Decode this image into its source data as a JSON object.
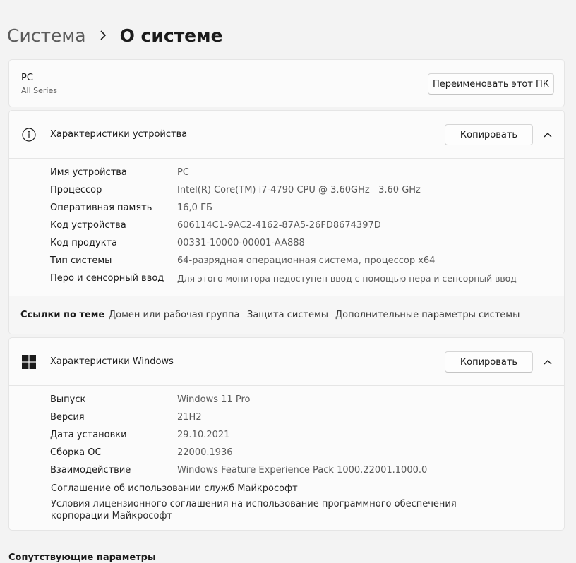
{
  "breadcrumb": {
    "parent": "Система",
    "current": "О системе"
  },
  "pc": {
    "name": "PC",
    "model": "All Series",
    "rename_label": "Переименовать этот ПК"
  },
  "device_specs": {
    "title": "Характеристики устройства",
    "copy_label": "Копировать",
    "rows": [
      {
        "label": "Имя устройства",
        "value": "PC"
      },
      {
        "label": "Процессор",
        "value": "Intel(R) Core(TM) i7-4790 CPU @ 3.60GHz   3.60 GHz"
      },
      {
        "label": "Оперативная память",
        "value": "16,0 ГБ"
      },
      {
        "label": "Код устройства",
        "value": "606114C1-9AC2-4162-87A5-26FD8674397D"
      },
      {
        "label": "Код продукта",
        "value": "00331-10000-00001-AA888"
      },
      {
        "label": "Тип системы",
        "value": "64-разрядная операционная система, процессор x64"
      },
      {
        "label": "Перо и сенсорный ввод",
        "value": "Для этого монитора недоступен ввод с помощью пера и сенсорный ввод"
      }
    ]
  },
  "related_links": {
    "title": "Ссылки по теме",
    "links": [
      "Домен или рабочая группа",
      "Защита системы",
      "Дополнительные параметры системы"
    ]
  },
  "windows_specs": {
    "title": "Характеристики Windows",
    "copy_label": "Копировать",
    "rows": [
      {
        "label": "Выпуск",
        "value": "Windows 11 Pro"
      },
      {
        "label": "Версия",
        "value": "21H2"
      },
      {
        "label": "Дата установки",
        "value": "29.10.2021"
      },
      {
        "label": "Сборка ОС",
        "value": "22000.1936"
      },
      {
        "label": "Взаимодействие",
        "value": "Windows Feature Experience Pack 1000.22001.1000.0"
      }
    ],
    "links": [
      "Соглашение об использовании служб Майкрософт",
      "Условия лицензионного соглашения на использование программного обеспечения корпорации Майкрософт"
    ]
  },
  "related_settings": {
    "title": "Сопутствующие параметры"
  },
  "icons": {
    "breadcrumb_separator": "chevron-right-icon",
    "device_section": "info-icon",
    "windows_section": "windows-logo-icon",
    "collapse": "chevron-up-icon"
  }
}
